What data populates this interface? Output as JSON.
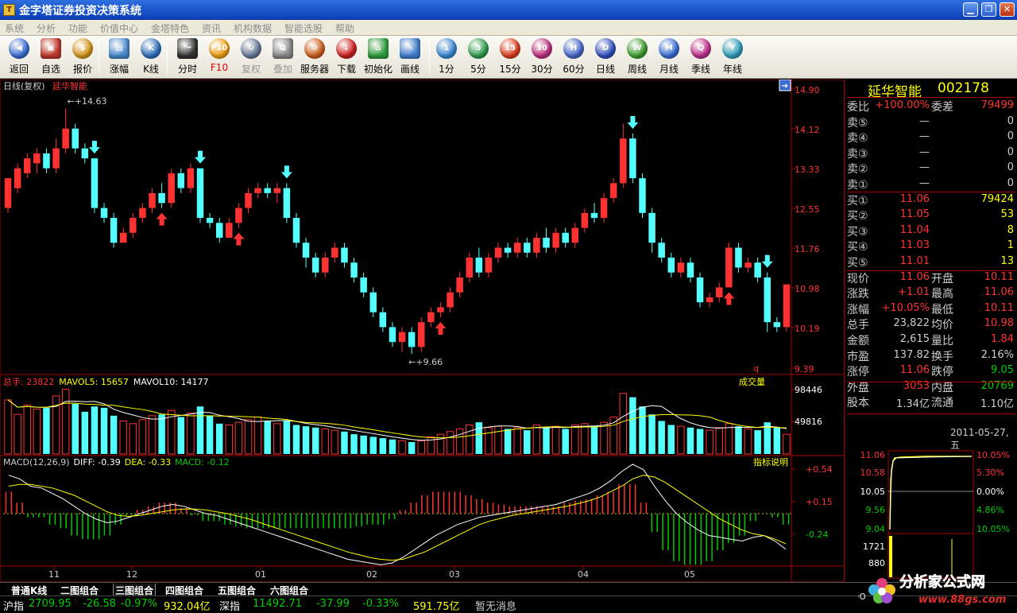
{
  "window": {
    "title": "金字塔证券投资决策系统",
    "logo": "T",
    "btn_min": "▁",
    "btn_max": "❐",
    "btn_close": "✕"
  },
  "menu": [
    "系统",
    "分析",
    "功能",
    "价值中心",
    "金塔特色",
    "资讯",
    "机构数据",
    "智能选股",
    "帮助"
  ],
  "toolbar": [
    {
      "label": "返回",
      "icon": "back-icon",
      "color": "#3b6fd8",
      "sym": "◀"
    },
    {
      "label": "自选",
      "icon": "basket-icon",
      "color": "#c0392b",
      "sym": "▣",
      "sq": true
    },
    {
      "label": "报价",
      "icon": "money-bag-icon",
      "color": "#d89a20",
      "sym": "$"
    },
    {
      "label": "涨幅",
      "icon": "trend-icon",
      "color": "#4a8cd0",
      "sym": "▤",
      "sq": true
    },
    {
      "label": "K线",
      "icon": "kline-icon",
      "color": "#3070c0",
      "sym": "K"
    },
    {
      "label": "分时",
      "icon": "timeshare-icon",
      "color": "#333",
      "sym": "〜",
      "sq": true
    },
    {
      "label": "F10",
      "icon": "f10-icon",
      "color": "#f0a010",
      "sym": "F10",
      "red": true
    },
    {
      "label": "复权",
      "icon": "restore-icon",
      "color": "#6a7a9a",
      "sym": "↻",
      "gray": true
    },
    {
      "label": "叠加",
      "icon": "overlay-icon",
      "color": "#8a8a8a",
      "sym": "⧉",
      "gray": true,
      "sq": true
    },
    {
      "label": "服务器",
      "icon": "server-icon",
      "color": "#d06020",
      "sym": "⚙"
    },
    {
      "label": "下载",
      "icon": "download-icon",
      "color": "#d02020",
      "sym": "↓"
    },
    {
      "label": "初始化",
      "icon": "home-icon",
      "color": "#30a040",
      "sym": "⌂",
      "sq": true
    },
    {
      "label": "画线",
      "icon": "draw-icon",
      "color": "#4080d0",
      "sym": "✎",
      "sq": true
    },
    {
      "label": "1分",
      "icon": "period-1-icon",
      "color": "#3a8ad8",
      "sym": "1"
    },
    {
      "label": "5分",
      "icon": "period-5-icon",
      "color": "#30a050",
      "sym": "5"
    },
    {
      "label": "15分",
      "icon": "period-15-icon",
      "color": "#e04020",
      "sym": "15"
    },
    {
      "label": "30分",
      "icon": "period-30-icon",
      "color": "#c03080",
      "sym": "30"
    },
    {
      "label": "60分",
      "icon": "period-60-icon",
      "color": "#4a6ad0",
      "sym": "H"
    },
    {
      "label": "日线",
      "icon": "daily-icon",
      "color": "#3050c0",
      "sym": "D"
    },
    {
      "label": "周线",
      "icon": "weekly-icon",
      "color": "#40a030",
      "sym": "W"
    },
    {
      "label": "月线",
      "icon": "monthly-icon",
      "color": "#3a70d8",
      "sym": "M"
    },
    {
      "label": "季线",
      "icon": "quarterly-icon",
      "color": "#c03090",
      "sym": "Q"
    },
    {
      "label": "年线",
      "icon": "yearly-icon",
      "color": "#30a0c0",
      "sym": "Y"
    }
  ],
  "main": {
    "header_left": "日线(复权)",
    "header_stock": "延华智能",
    "high_mark": "←+14.63",
    "low_mark": "←+9.66",
    "q_mark": "q",
    "price_axis": [
      "14.90",
      "14.12",
      "13.33",
      "12.55",
      "11.76",
      "10.98",
      "10.19",
      "9.39"
    ],
    "vol_header": {
      "prefix": "总手: ",
      "value": "23822",
      "ma5": "MAVOL5: 15657",
      "ma10": "MAVOL10: 14177",
      "title": "成交量"
    },
    "vol_axis": [
      "98446",
      "49816"
    ],
    "macd_header": {
      "name": "MACD(12,26,9)",
      "diff": "DIFF: -0.39",
      "dea": "DEA: -0.33",
      "macd": "MACD: -0.12",
      "help": "指标说明"
    },
    "macd_axis": [
      "+0.54",
      "+0.15",
      "-0.24"
    ],
    "date_axis": [
      "11",
      "12",
      "01",
      "02",
      "03",
      "04",
      "05"
    ]
  },
  "quote": {
    "name": "延华智能",
    "code": "002178",
    "rows": [
      {
        "l": "委比",
        "v1": "+100.00%",
        "c1": "#f33",
        "l2": "委差",
        "v2": "79499",
        "c2": "#f33"
      },
      {
        "l": "卖⑤",
        "v1": "—",
        "c1": "#ccc",
        "v2": "0",
        "c2": "#ccc"
      },
      {
        "l": "卖④",
        "v1": "—",
        "c1": "#ccc",
        "v2": "0",
        "c2": "#ccc"
      },
      {
        "l": "卖③",
        "v1": "—",
        "c1": "#ccc",
        "v2": "0",
        "c2": "#ccc"
      },
      {
        "l": "卖②",
        "v1": "—",
        "c1": "#ccc",
        "v2": "0",
        "c2": "#ccc"
      },
      {
        "l": "卖①",
        "v1": "—",
        "c1": "#ccc",
        "v2": "0",
        "c2": "#ccc"
      },
      {
        "l": "买①",
        "v1": "11.06",
        "c1": "#f33",
        "v2": "79424",
        "c2": "#ff0"
      },
      {
        "l": "买②",
        "v1": "11.05",
        "c1": "#f33",
        "v2": "53",
        "c2": "#ff0"
      },
      {
        "l": "买③",
        "v1": "11.04",
        "c1": "#f33",
        "v2": "8",
        "c2": "#ff0"
      },
      {
        "l": "买④",
        "v1": "11.03",
        "c1": "#f33",
        "v2": "1",
        "c2": "#ff0"
      },
      {
        "l": "买⑤",
        "v1": "11.01",
        "c1": "#f33",
        "v2": "13",
        "c2": "#ff0"
      },
      {
        "l": "现价",
        "v1": "11.06",
        "c1": "#f33",
        "l2": "开盘",
        "v2": "10.11",
        "c2": "#f33"
      },
      {
        "l": "涨跌",
        "v1": "+1.01",
        "c1": "#f33",
        "l2": "最高",
        "v2": "11.06",
        "c2": "#f33"
      },
      {
        "l": "涨幅",
        "v1": "+10.05%",
        "c1": "#f33",
        "l2": "最低",
        "v2": "10.11",
        "c2": "#f33"
      },
      {
        "l": "总手",
        "v1": "23,822",
        "c1": "#ccc",
        "l2": "均价",
        "v2": "10.98",
        "c2": "#f33"
      },
      {
        "l": "金额",
        "v1": "2,615",
        "c1": "#ccc",
        "l2": "量比",
        "v2": "1.84",
        "c2": "#f33"
      },
      {
        "l": "市盈",
        "v1": "137.82",
        "c1": "#ccc",
        "l2": "换手",
        "v2": "2.16%",
        "c2": "#ccc"
      },
      {
        "l": "涨停",
        "v1": "11.06",
        "c1": "#f33",
        "l2": "跌停",
        "v2": "9.05",
        "c2": "#0c0"
      },
      {
        "l": "外盘",
        "v1": "3053",
        "c1": "#f33",
        "l2": "内盘",
        "v2": "20769",
        "c2": "#0c0"
      },
      {
        "l": "股本",
        "v1": "1.34亿",
        "c1": "#ccc",
        "l2": "流通",
        "v2": "1.10亿",
        "c2": "#ccc"
      }
    ],
    "date": "2011-05-27,五",
    "mini_left": [
      "11.06",
      "10.58",
      "10.05",
      "9.56",
      "9.04",
      "1721",
      "880"
    ],
    "mini_right": [
      "10.05%",
      "5.30%",
      "0.00%",
      "4.86%",
      "10.05%"
    ]
  },
  "tabs": [
    "普通K线",
    "二图组合",
    "三图组合",
    "四图组合",
    "五图组合",
    "六图组合"
  ],
  "active_tab": "三图组合",
  "status": {
    "sh_label": "沪指",
    "sh_val": "2709.95",
    "sh_chg": "-26.58",
    "sh_pct": "-0.97%",
    "sh_amt": "932.04亿",
    "sz_label": "深指",
    "sz_val": "11492.71",
    "sz_chg": "-37.99",
    "sz_pct": "-0.33%",
    "sz_amt": "591.75亿",
    "msg": "暂无消息"
  },
  "watermark": {
    "text": "分析家公式网",
    "url": "www.88gs.com",
    "corner": "Goo"
  },
  "colors": {
    "up": "#ff3232",
    "down": "#54ffff",
    "axis_red": "#aa0000",
    "yellow": "#ffff00",
    "green": "#00cc00"
  },
  "chart_data": {
    "type": "candlestick",
    "stock": "延华智能",
    "ylim": [
      9.39,
      14.9
    ],
    "high": 14.63,
    "low": 9.66,
    "candles": [
      [
        12.6,
        13.2,
        13.2,
        12.5
      ],
      [
        13.0,
        13.4,
        13.5,
        12.9
      ],
      [
        13.3,
        13.6,
        13.7,
        13.2
      ],
      [
        13.5,
        13.7,
        13.8,
        13.3
      ],
      [
        13.7,
        13.4,
        13.8,
        13.3
      ],
      [
        13.4,
        13.8,
        14.0,
        13.3
      ],
      [
        13.8,
        14.2,
        14.6,
        13.7
      ],
      [
        14.2,
        13.8,
        14.3,
        13.7
      ],
      [
        13.8,
        13.6,
        13.9,
        13.5
      ],
      [
        13.6,
        12.6,
        13.6,
        12.5
      ],
      [
        12.6,
        12.4,
        12.7,
        12.3
      ],
      [
        12.4,
        11.9,
        12.5,
        11.8
      ],
      [
        11.9,
        12.1,
        12.2,
        11.9
      ],
      [
        12.1,
        12.4,
        12.5,
        12.0
      ],
      [
        12.4,
        12.6,
        12.7,
        12.3
      ],
      [
        12.6,
        12.9,
        13.0,
        12.5
      ],
      [
        12.9,
        12.7,
        13.1,
        12.6
      ],
      [
        12.7,
        13.3,
        13.4,
        12.6
      ],
      [
        13.3,
        13.0,
        13.4,
        12.9
      ],
      [
        13.0,
        13.4,
        13.5,
        12.9
      ],
      [
        13.4,
        12.4,
        13.4,
        12.3
      ],
      [
        12.4,
        12.3,
        12.5,
        12.2
      ],
      [
        12.3,
        12.0,
        12.4,
        11.9
      ],
      [
        12.0,
        12.3,
        12.4,
        12.0
      ],
      [
        12.3,
        12.6,
        12.7,
        12.2
      ],
      [
        12.6,
        12.9,
        13.0,
        12.5
      ],
      [
        12.9,
        13.0,
        13.1,
        12.8
      ],
      [
        13.0,
        12.9,
        13.1,
        12.8
      ],
      [
        12.9,
        13.0,
        13.1,
        12.7
      ],
      [
        13.0,
        12.4,
        13.1,
        12.3
      ],
      [
        12.4,
        11.9,
        12.5,
        11.8
      ],
      [
        11.9,
        11.6,
        12.0,
        11.4
      ],
      [
        11.6,
        11.3,
        11.7,
        11.2
      ],
      [
        11.3,
        11.6,
        11.7,
        11.2
      ],
      [
        11.6,
        11.8,
        11.9,
        11.5
      ],
      [
        11.8,
        11.5,
        11.9,
        11.4
      ],
      [
        11.5,
        11.2,
        11.6,
        11.1
      ],
      [
        11.2,
        10.9,
        11.3,
        10.8
      ],
      [
        10.9,
        10.5,
        11.0,
        10.4
      ],
      [
        10.5,
        10.2,
        10.6,
        10.1
      ],
      [
        10.2,
        9.9,
        10.3,
        9.8
      ],
      [
        9.9,
        10.1,
        10.2,
        9.7
      ],
      [
        10.1,
        9.8,
        10.2,
        9.66
      ],
      [
        9.8,
        10.3,
        10.4,
        9.7
      ],
      [
        10.3,
        10.5,
        10.6,
        10.2
      ],
      [
        10.5,
        10.6,
        10.7,
        10.4
      ],
      [
        10.6,
        10.9,
        11.0,
        10.5
      ],
      [
        10.9,
        11.2,
        11.3,
        10.8
      ],
      [
        11.2,
        11.6,
        11.7,
        11.1
      ],
      [
        11.6,
        11.3,
        11.8,
        11.2
      ],
      [
        11.3,
        11.6,
        11.7,
        11.2
      ],
      [
        11.6,
        11.8,
        11.9,
        11.5
      ],
      [
        11.8,
        11.7,
        11.9,
        11.6
      ],
      [
        11.7,
        11.9,
        12.0,
        11.6
      ],
      [
        11.9,
        11.7,
        12.0,
        11.6
      ],
      [
        11.7,
        12.0,
        12.1,
        11.6
      ],
      [
        12.0,
        11.8,
        12.2,
        11.7
      ],
      [
        11.8,
        12.1,
        12.2,
        11.7
      ],
      [
        12.1,
        11.9,
        12.2,
        11.8
      ],
      [
        11.9,
        12.2,
        12.3,
        11.8
      ],
      [
        12.2,
        12.5,
        12.6,
        12.1
      ],
      [
        12.5,
        12.4,
        12.7,
        12.3
      ],
      [
        12.4,
        12.8,
        12.9,
        12.3
      ],
      [
        12.8,
        13.1,
        13.2,
        12.7
      ],
      [
        13.1,
        14.0,
        14.3,
        13.0
      ],
      [
        14.0,
        13.2,
        14.1,
        13.1
      ],
      [
        13.2,
        12.5,
        13.3,
        12.4
      ],
      [
        12.5,
        11.9,
        12.6,
        11.7
      ],
      [
        11.9,
        11.6,
        12.0,
        11.5
      ],
      [
        11.6,
        11.3,
        11.7,
        11.2
      ],
      [
        11.3,
        11.5,
        11.6,
        11.2
      ],
      [
        11.5,
        11.2,
        11.6,
        11.1
      ],
      [
        11.2,
        10.7,
        11.3,
        10.6
      ],
      [
        10.7,
        10.8,
        10.9,
        10.6
      ],
      [
        10.8,
        11.0,
        11.1,
        10.7
      ],
      [
        11.0,
        11.8,
        11.9,
        11.0
      ],
      [
        11.8,
        11.4,
        11.9,
        11.3
      ],
      [
        11.4,
        11.5,
        11.6,
        11.3
      ],
      [
        11.5,
        11.2,
        11.6,
        11.1
      ],
      [
        11.2,
        10.3,
        11.3,
        10.1
      ],
      [
        10.3,
        10.2,
        10.4,
        10.1
      ],
      [
        10.2,
        11.06,
        11.06,
        10.11
      ]
    ],
    "volume": [
      82,
      60,
      74,
      68,
      70,
      88,
      98,
      76,
      64,
      72,
      70,
      58,
      50,
      46,
      52,
      58,
      60,
      66,
      56,
      62,
      72,
      58,
      46,
      44,
      48,
      52,
      56,
      50,
      46,
      50,
      44,
      42,
      40,
      38,
      36,
      34,
      30,
      28,
      26,
      24,
      22,
      20,
      18,
      20,
      26,
      30,
      34,
      38,
      44,
      48,
      40,
      42,
      38,
      40,
      36,
      44,
      40,
      42,
      38,
      44,
      46,
      42,
      48,
      56,
      92,
      86,
      72,
      60,
      50,
      44,
      42,
      40,
      38,
      36,
      40,
      46,
      42,
      38,
      36,
      48,
      40,
      30
    ],
    "diff": [
      0.42,
      0.38,
      0.3,
      0.28,
      0.22,
      0.16,
      0.08,
      0.0,
      -0.06,
      -0.1,
      -0.08,
      -0.04,
      0.0,
      0.04,
      0.08,
      0.1,
      0.08,
      0.04,
      0.0,
      -0.02,
      -0.06,
      -0.1,
      -0.14,
      -0.18,
      -0.22,
      -0.26,
      -0.3,
      -0.34,
      -0.38,
      -0.42,
      -0.46,
      -0.5,
      -0.52,
      -0.54,
      -0.56,
      -0.54,
      -0.48,
      -0.4,
      -0.32,
      -0.24,
      -0.18,
      -0.12,
      -0.08,
      -0.04,
      -0.02,
      0.0,
      0.02,
      0.04,
      0.06,
      0.08,
      0.1,
      0.14,
      0.18,
      0.22,
      0.28,
      0.36,
      0.46,
      0.54,
      0.48,
      0.3,
      0.14,
      0.0,
      -0.1,
      -0.18,
      -0.24,
      -0.26,
      -0.28,
      -0.3,
      -0.26,
      -0.24,
      -0.3,
      -0.39
    ],
    "dea": [
      0.3,
      0.32,
      0.32,
      0.3,
      0.28,
      0.24,
      0.2,
      0.14,
      0.08,
      0.02,
      -0.02,
      -0.03,
      -0.02,
      0.0,
      0.02,
      0.04,
      0.05,
      0.05,
      0.04,
      0.02,
      0.0,
      -0.03,
      -0.06,
      -0.1,
      -0.14,
      -0.18,
      -0.22,
      -0.26,
      -0.3,
      -0.34,
      -0.38,
      -0.42,
      -0.45,
      -0.48,
      -0.5,
      -0.51,
      -0.5,
      -0.46,
      -0.42,
      -0.36,
      -0.3,
      -0.24,
      -0.18,
      -0.12,
      -0.08,
      -0.05,
      -0.02,
      0.0,
      0.02,
      0.04,
      0.06,
      0.08,
      0.11,
      0.14,
      0.18,
      0.24,
      0.3,
      0.38,
      0.42,
      0.4,
      0.34,
      0.26,
      0.18,
      0.1,
      0.02,
      -0.06,
      -0.12,
      -0.18,
      -0.22,
      -0.24,
      -0.28,
      -0.33
    ]
  }
}
